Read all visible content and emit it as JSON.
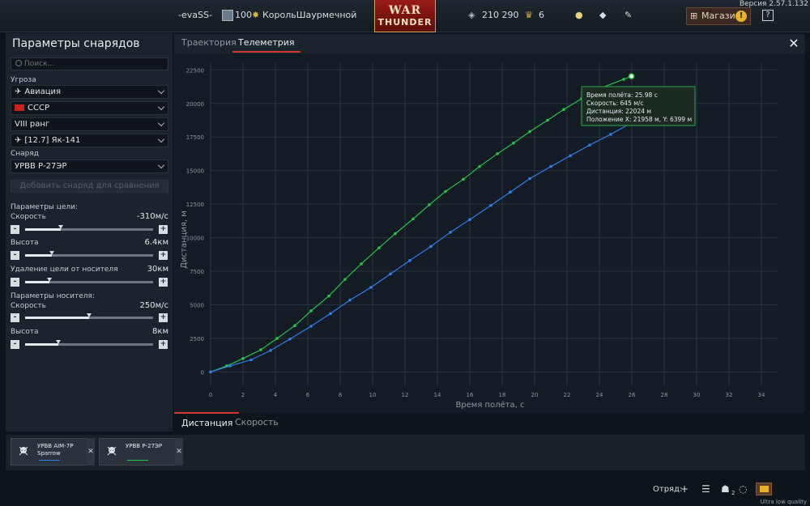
{
  "topbar": {
    "username": "-evaSS-",
    "level": "100",
    "title": "КорольШаурмечной",
    "logo_line1": "WAR",
    "logo_line2": "THUNDER",
    "silver_lions": "210 290",
    "golden_eagles": "6",
    "shop_label": "Магазин",
    "version": "Версия 2.57.1.132",
    "help": "?"
  },
  "left_panel": {
    "title": "Параметры снарядов",
    "search_placeholder": "Поиск...",
    "threat_label": "Угроза",
    "threat_type": "Авиация",
    "country": "СССР",
    "rank": "VIII ранг",
    "aircraft": "[12.7] Як-141",
    "shell_label": "Снаряд",
    "shell": "УРВВ Р-27ЭР",
    "add_compare": "Добавить снаряд для сравнения",
    "target_params_label": "Параметры цели:",
    "target_speed_label": "Скорость",
    "target_speed_value": "-310м/с",
    "target_speed_level": 0.28,
    "target_alt_label": "Высота",
    "target_alt_value": "6.4км",
    "target_alt_level": 0.21,
    "target_dist_label": "Удаление цели от носителя",
    "target_dist_value": "30км",
    "target_dist_level": 0.19,
    "carrier_params_label": "Параметры носителя:",
    "carrier_speed_label": "Скорость",
    "carrier_speed_value": "250м/с",
    "carrier_speed_level": 0.5,
    "carrier_alt_label": "Высота",
    "carrier_alt_value": "8км",
    "carrier_alt_level": 0.26,
    "minus": "-",
    "plus": "+"
  },
  "main": {
    "tab_trajectory": "Траектория",
    "tab_telemetry": "Телеметрия",
    "bottom_tab_distance": "Дистанция",
    "bottom_tab_speed": "Скорость",
    "close": "✕"
  },
  "tooltip": {
    "line1": "Время полёта: 25.98 с",
    "line2": "Скорость: 645 м/с",
    "line3": "Дистанция: 22024 м",
    "line4": "Положение X: 21958 м, Y: 6399 м"
  },
  "compare": {
    "card1_name": "УРВВ AIM-7P Sparrow",
    "card2_name": "УРВВ Р-27ЭР",
    "remove": "✕"
  },
  "bottombar": {
    "squad": "Отряд:",
    "squad_count": "2",
    "quality": "Ultra low quality"
  },
  "colors": {
    "green_series": "#27c24a",
    "blue_series": "#2f7fe8",
    "accent_red": "#d33a2c"
  },
  "chart_data": {
    "type": "line",
    "xlabel": "Время полёта, с",
    "ylabel": "Дистанция, м",
    "xlim": [
      0,
      35
    ],
    "ylim": [
      -1000,
      23000
    ],
    "xticks": [
      0,
      2,
      4,
      6,
      8,
      10,
      12,
      14,
      16,
      18,
      20,
      22,
      24,
      26,
      28,
      30,
      32,
      34
    ],
    "yticks": [
      0,
      2500,
      5000,
      7500,
      10000,
      12500,
      15000,
      17500,
      20000,
      22500
    ],
    "series": [
      {
        "name": "УРВВ Р-27ЭР",
        "color": "#27c24a",
        "x": [
          0,
          1,
          2,
          3.1,
          4.1,
          5.2,
          6.2,
          7.3,
          8.3,
          9.3,
          10.4,
          11.4,
          12.5,
          13.5,
          14.5,
          15.6,
          16.6,
          17.7,
          18.7,
          19.7,
          20.8,
          21.8,
          22.9,
          23.9,
          25.5,
          25.98
        ],
        "y": [
          0,
          450,
          1000,
          1650,
          2500,
          3450,
          4550,
          5650,
          6900,
          8050,
          9250,
          10300,
          11400,
          12450,
          13450,
          14350,
          15300,
          16250,
          17050,
          17900,
          18750,
          19550,
          20350,
          21050,
          21800,
          22024
        ]
      },
      {
        "name": "УРВВ AIM-7P Sparrow",
        "color": "#2f7fe8",
        "x": [
          0,
          1.2,
          2.5,
          3.7,
          4.9,
          6.2,
          7.4,
          8.6,
          9.9,
          11.1,
          12.3,
          13.6,
          14.8,
          16.0,
          17.3,
          18.5,
          19.7,
          21.0,
          22.2,
          23.4,
          24.7,
          25.9,
          27.1,
          28.4,
          29.6
        ],
        "y": [
          0,
          450,
          900,
          1600,
          2450,
          3400,
          4350,
          5350,
          6300,
          7300,
          8300,
          9350,
          10400,
          11350,
          12400,
          13400,
          14400,
          15300,
          16100,
          16900,
          17700,
          18500,
          19300,
          20100,
          20850
        ]
      }
    ]
  }
}
